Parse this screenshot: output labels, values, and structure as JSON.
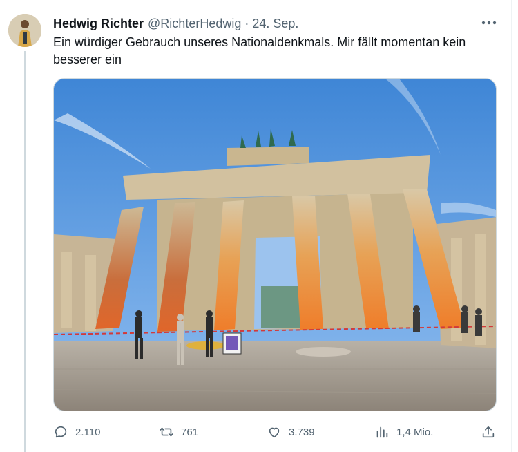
{
  "author": {
    "name": "Hedwig Richter",
    "handle": "@RichterHedwig",
    "separator": "·",
    "date": "24. Sep."
  },
  "tweet": {
    "text": "Ein würdiger Gebrauch unseres Nationaldenkmals. Mir fällt momentan kein besserer ein"
  },
  "metrics": {
    "replies": "2.110",
    "retweets": "761",
    "likes": "3.739",
    "views": "1,4 Mio."
  },
  "icons": {
    "more": "more-horizontal-icon",
    "reply": "speech-bubble-icon",
    "retweet": "retweet-arrows-icon",
    "like": "heart-icon",
    "views": "bar-chart-icon",
    "share": "upload-share-icon"
  },
  "colors": {
    "text": "#0f1419",
    "secondary": "#536471",
    "border": "#cfd9de",
    "paint_orange": "#f08a2c"
  }
}
